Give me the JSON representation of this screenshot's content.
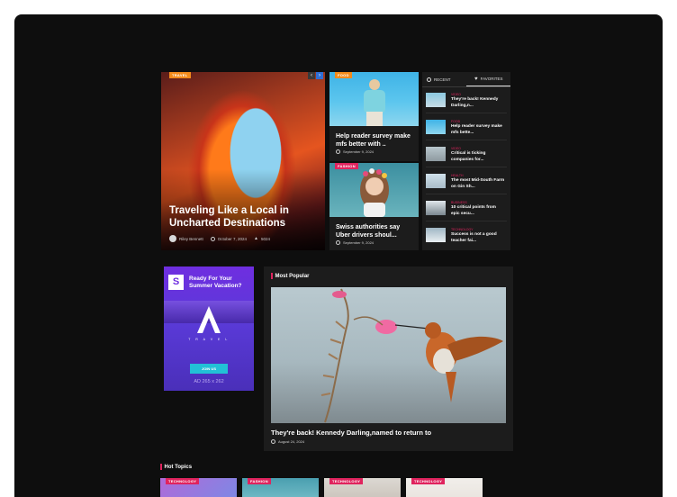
{
  "hero": {
    "category": "TRAVEL",
    "title": "Traveling Like a Local in Uncharted Destinations",
    "author": "Riley Bennett",
    "date": "October 7, 2024",
    "views": "5024",
    "prev": "‹",
    "next": "›"
  },
  "mid_cards": [
    {
      "category": "FOOD",
      "title": "Help reader survey make mfs better with ..",
      "date": "September 9, 2024"
    },
    {
      "category": "FASHION",
      "title": "Swiss authorities say Uber drivers shoul...",
      "date": "September 9, 2024"
    }
  ],
  "sidebar": {
    "tab_recent": "RECENT",
    "tab_favorites": "FAVORITES",
    "items": [
      {
        "category": "VIDEO",
        "title": "They're back! Kennedy Darling,n..."
      },
      {
        "category": "FOOD",
        "title": "Help reader survey make mfs bette..."
      },
      {
        "category": "VIDEO",
        "title": "Critical is ticking companies for..."
      },
      {
        "category": "HEALTH",
        "title": "The most Mid-South Farm on Gin Sh..."
      },
      {
        "category": "BUSINESS",
        "title": "10 critical points from epic secu..."
      },
      {
        "category": "TECHNOLOGY",
        "title": "Success is not a good teacher fai..."
      }
    ]
  },
  "ad": {
    "logo_letter": "S",
    "headline": "Ready For Your Summer Vacation?",
    "brand": "T R A V E L",
    "button": "JOIN US",
    "size": "AD 265 x 262"
  },
  "popular": {
    "heading": "Most Popular",
    "title": "They're back! Kennedy Darling,named to return to",
    "date": "August 24, 2024"
  },
  "hot_topics": {
    "heading": "Hot Topics",
    "cards": [
      {
        "category": "TECHNOLOGY"
      },
      {
        "category": "FASHION"
      },
      {
        "category": "TECHNOLOGY"
      },
      {
        "category": "TECHNOLOGY"
      }
    ]
  },
  "colors": {
    "accent_pink": "#e0245e",
    "accent_orange": "#f28b1b",
    "panel": "#1c1c1c",
    "background": "#0e0e0e"
  }
}
